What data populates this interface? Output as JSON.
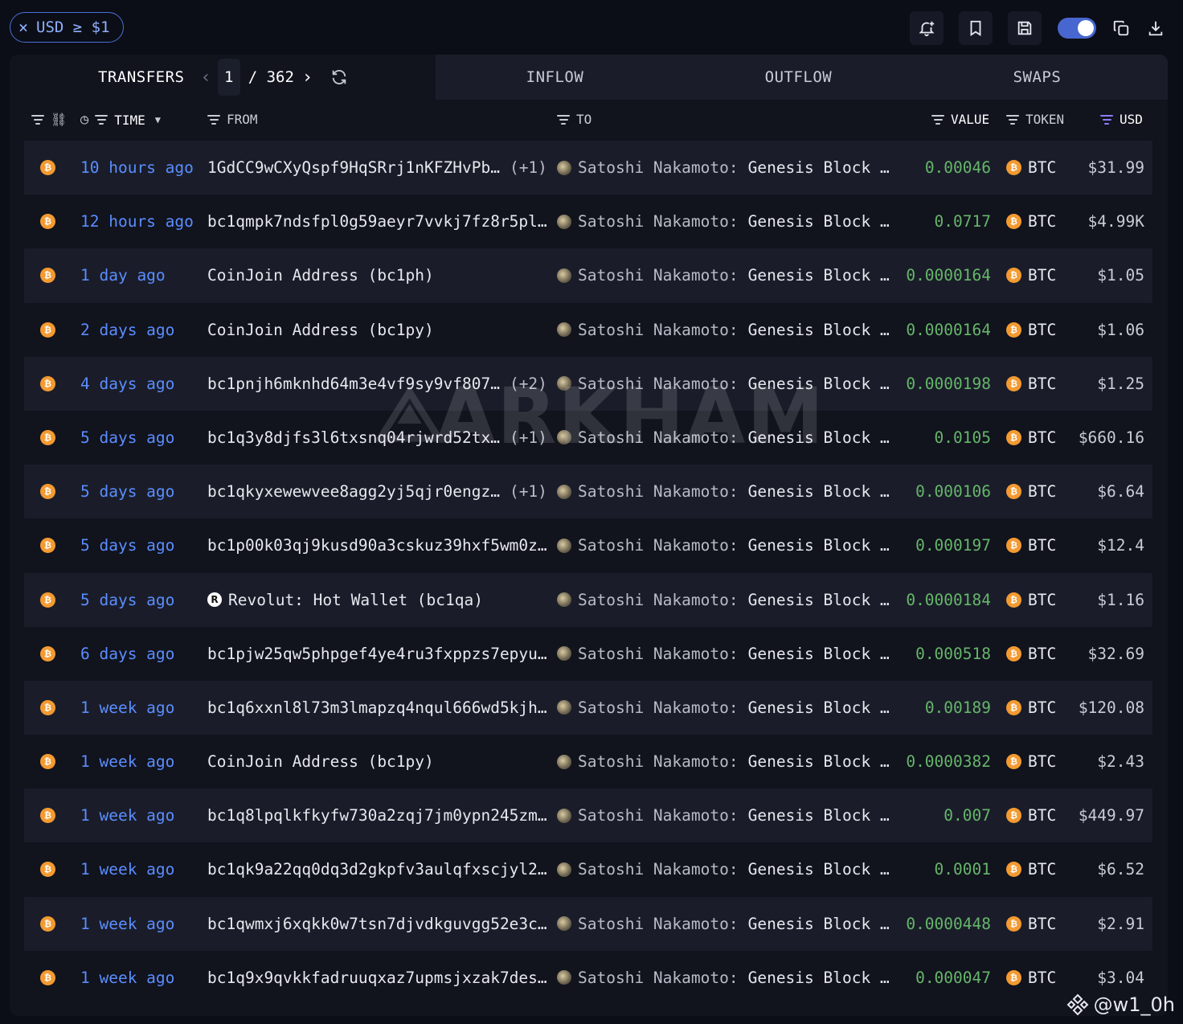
{
  "filter_chip": {
    "label": "USD ≥ $1",
    "close_glyph": "×"
  },
  "toolbar": {
    "icons": [
      "bell-plus-icon",
      "bookmark-icon",
      "save-icon",
      "toggle",
      "copy-icon",
      "download-icon"
    ]
  },
  "tabs": {
    "transfers": "TRANSFERS",
    "page": "1",
    "total_pages": "/ 362",
    "inflow": "INFLOW",
    "outflow": "OUTFLOW",
    "swaps": "SWAPS"
  },
  "columns": {
    "time": "TIME",
    "from": "FROM",
    "to": "TO",
    "value": "VALUE",
    "token": "TOKEN",
    "usd": "USD"
  },
  "accent_colors": {
    "link_blue": "#5b8dff",
    "value_green": "#66b56b",
    "btc_orange": "#f39a31",
    "toggle": "#4766cf"
  },
  "rows": [
    {
      "time": "10 hours ago",
      "from": "1GdCC9wCXyQspf9HqSRrj1nKFZHvPb…",
      "from_extra": "(+1)",
      "from_icon": "",
      "to_entity": "Satoshi Nakamoto:",
      "to_label": "Genesis Block …",
      "value": "0.00046",
      "token": "BTC",
      "usd": "$31.99"
    },
    {
      "time": "12 hours ago",
      "from": "bc1qmpk7ndsfpl0g59aeyr7vvkj7fz8r5pl…",
      "from_extra": "",
      "from_icon": "",
      "to_entity": "Satoshi Nakamoto:",
      "to_label": "Genesis Block …",
      "value": "0.0717",
      "token": "BTC",
      "usd": "$4.99K"
    },
    {
      "time": "1 day ago",
      "from": "CoinJoin Address (bc1ph)",
      "from_extra": "",
      "from_icon": "",
      "to_entity": "Satoshi Nakamoto:",
      "to_label": "Genesis Block …",
      "value": "0.0000164",
      "token": "BTC",
      "usd": "$1.05"
    },
    {
      "time": "2 days ago",
      "from": "CoinJoin Address (bc1py)",
      "from_extra": "",
      "from_icon": "",
      "to_entity": "Satoshi Nakamoto:",
      "to_label": "Genesis Block …",
      "value": "0.0000164",
      "token": "BTC",
      "usd": "$1.06"
    },
    {
      "time": "4 days ago",
      "from": "bc1pnjh6mknhd64m3e4vf9sy9vf807…",
      "from_extra": "(+2)",
      "from_icon": "",
      "to_entity": "Satoshi Nakamoto:",
      "to_label": "Genesis Block …",
      "value": "0.0000198",
      "token": "BTC",
      "usd": "$1.25"
    },
    {
      "time": "5 days ago",
      "from": "bc1q3y8djfs3l6txsnq04rjwrd52tx…",
      "from_extra": "(+1)",
      "from_icon": "",
      "to_entity": "Satoshi Nakamoto:",
      "to_label": "Genesis Block …",
      "value": "0.0105",
      "token": "BTC",
      "usd": "$660.16"
    },
    {
      "time": "5 days ago",
      "from": "bc1qkyxewewvee8agg2yj5qjr0engz…",
      "from_extra": "(+1)",
      "from_icon": "",
      "to_entity": "Satoshi Nakamoto:",
      "to_label": "Genesis Block …",
      "value": "0.000106",
      "token": "BTC",
      "usd": "$6.64"
    },
    {
      "time": "5 days ago",
      "from": "bc1p00k03qj9kusd90a3cskuz39hxf5wm0z…",
      "from_extra": "",
      "from_icon": "",
      "to_entity": "Satoshi Nakamoto:",
      "to_label": "Genesis Block …",
      "value": "0.000197",
      "token": "BTC",
      "usd": "$12.4"
    },
    {
      "time": "5 days ago",
      "from": "Revolut: Hot Wallet (bc1qa)",
      "from_extra": "",
      "from_icon": "R",
      "to_entity": "Satoshi Nakamoto:",
      "to_label": "Genesis Block …",
      "value": "0.0000184",
      "token": "BTC",
      "usd": "$1.16"
    },
    {
      "time": "6 days ago",
      "from": "bc1pjw25qw5phpgef4ye4ru3fxppzs7epyu…",
      "from_extra": "",
      "from_icon": "",
      "to_entity": "Satoshi Nakamoto:",
      "to_label": "Genesis Block …",
      "value": "0.000518",
      "token": "BTC",
      "usd": "$32.69"
    },
    {
      "time": "1 week ago",
      "from": "bc1q6xxnl8l73m3lmapzq4nqul666wd5kjh…",
      "from_extra": "",
      "from_icon": "",
      "to_entity": "Satoshi Nakamoto:",
      "to_label": "Genesis Block …",
      "value": "0.00189",
      "token": "BTC",
      "usd": "$120.08"
    },
    {
      "time": "1 week ago",
      "from": "CoinJoin Address (bc1py)",
      "from_extra": "",
      "from_icon": "",
      "to_entity": "Satoshi Nakamoto:",
      "to_label": "Genesis Block …",
      "value": "0.0000382",
      "token": "BTC",
      "usd": "$2.43"
    },
    {
      "time": "1 week ago",
      "from": "bc1q8lpqlkfkyfw730a2zqj7jm0ypn245zm…",
      "from_extra": "",
      "from_icon": "",
      "to_entity": "Satoshi Nakamoto:",
      "to_label": "Genesis Block …",
      "value": "0.007",
      "token": "BTC",
      "usd": "$449.97"
    },
    {
      "time": "1 week ago",
      "from": "bc1qk9a22qq0dq3d2gkpfv3aulqfxscjyl2…",
      "from_extra": "",
      "from_icon": "",
      "to_entity": "Satoshi Nakamoto:",
      "to_label": "Genesis Block …",
      "value": "0.0001",
      "token": "BTC",
      "usd": "$6.52"
    },
    {
      "time": "1 week ago",
      "from": "bc1qwmxj6xqkk0w7tsn7djvdkguvgg52e3c…",
      "from_extra": "",
      "from_icon": "",
      "to_entity": "Satoshi Nakamoto:",
      "to_label": "Genesis Block …",
      "value": "0.0000448",
      "token": "BTC",
      "usd": "$2.91"
    },
    {
      "time": "1 week ago",
      "from": "bc1q9x9qvkkfadruuqxaz7upmsjxzak7des…",
      "from_extra": "",
      "from_icon": "",
      "to_entity": "Satoshi Nakamoto:",
      "to_label": "Genesis Block …",
      "value": "0.000047",
      "token": "BTC",
      "usd": "$3.04"
    }
  ],
  "watermark": "ARKHAM",
  "credit": "@w1_0h"
}
